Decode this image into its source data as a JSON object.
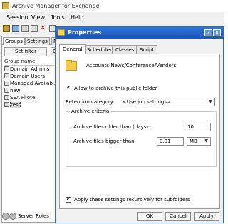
{
  "main_window": {
    "title": "Archive Manager for Exchange",
    "menu": [
      "Session",
      "View",
      "Tools",
      "Help"
    ],
    "left_tabs": [
      "Groups",
      "Settings",
      "P"
    ],
    "set_filter_label": "Set filter",
    "set_filter2_label": "C",
    "list_header": "Group name",
    "groups": [
      "Domain Admins",
      "Domain Users",
      "Managed Availabi...",
      "new",
      "SEA Pilote",
      "test"
    ],
    "selected_group": "test",
    "status_text": "Server Roles"
  },
  "dialog": {
    "title": "Properties",
    "help_glyph": "?",
    "close_glyph": "X",
    "tabs": [
      "General",
      "Scheduler",
      "Classes",
      "Script"
    ],
    "active_tab": "General",
    "folder_path": "Accounts-News/Conference/Vendors",
    "allow_archive_label": "Allow to archive this public folder",
    "allow_archive_checked": true,
    "retention_label": "Retention category:",
    "retention_value": "<Use job settings>",
    "criteria_group_title": "Archive criteria",
    "older_than_label": "Archive files older than (days):",
    "older_than_value": "10",
    "bigger_than_label": "Archive files bigger than:",
    "bigger_than_value": "0.01",
    "size_unit_value": "MB",
    "apply_recursive_label": "Apply these settings recursively for subfolders",
    "apply_recursive_checked": true,
    "buttons": {
      "ok": "OK",
      "cancel": "Cancel",
      "apply": "Apply"
    }
  },
  "colors": {
    "dialog_title_bar": "#1c56b8",
    "folder": "#f3cc4a"
  }
}
